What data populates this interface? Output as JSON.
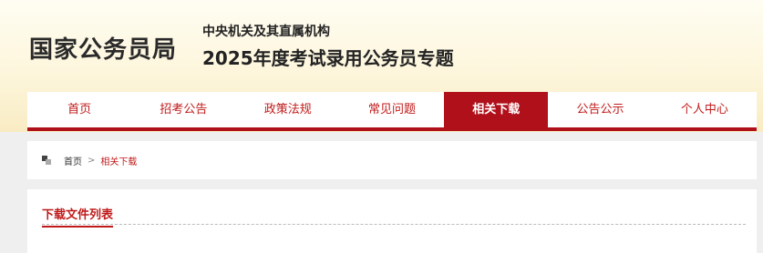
{
  "header": {
    "site_title": "国家公务员局",
    "subtitle_line1": "中央机关及其直属机构",
    "subtitle_line2": "2025年度考试录用公务员专题"
  },
  "nav": {
    "items": [
      {
        "label": "首页"
      },
      {
        "label": "招考公告"
      },
      {
        "label": "政策法规"
      },
      {
        "label": "常见问题"
      },
      {
        "label": "相关下载"
      },
      {
        "label": "公告公示"
      },
      {
        "label": "个人中心"
      }
    ],
    "active_index": 4
  },
  "breadcrumb": {
    "icon": "breadcrumb-icon",
    "home": "首页",
    "separator": ">",
    "current": "相关下载"
  },
  "panel": {
    "title": "下载文件列表"
  },
  "colors": {
    "accent": "#b0101a",
    "header_bg_top": "#fffdf3",
    "header_bg_bottom": "#f9ecc4",
    "page_bg": "#efefef"
  }
}
